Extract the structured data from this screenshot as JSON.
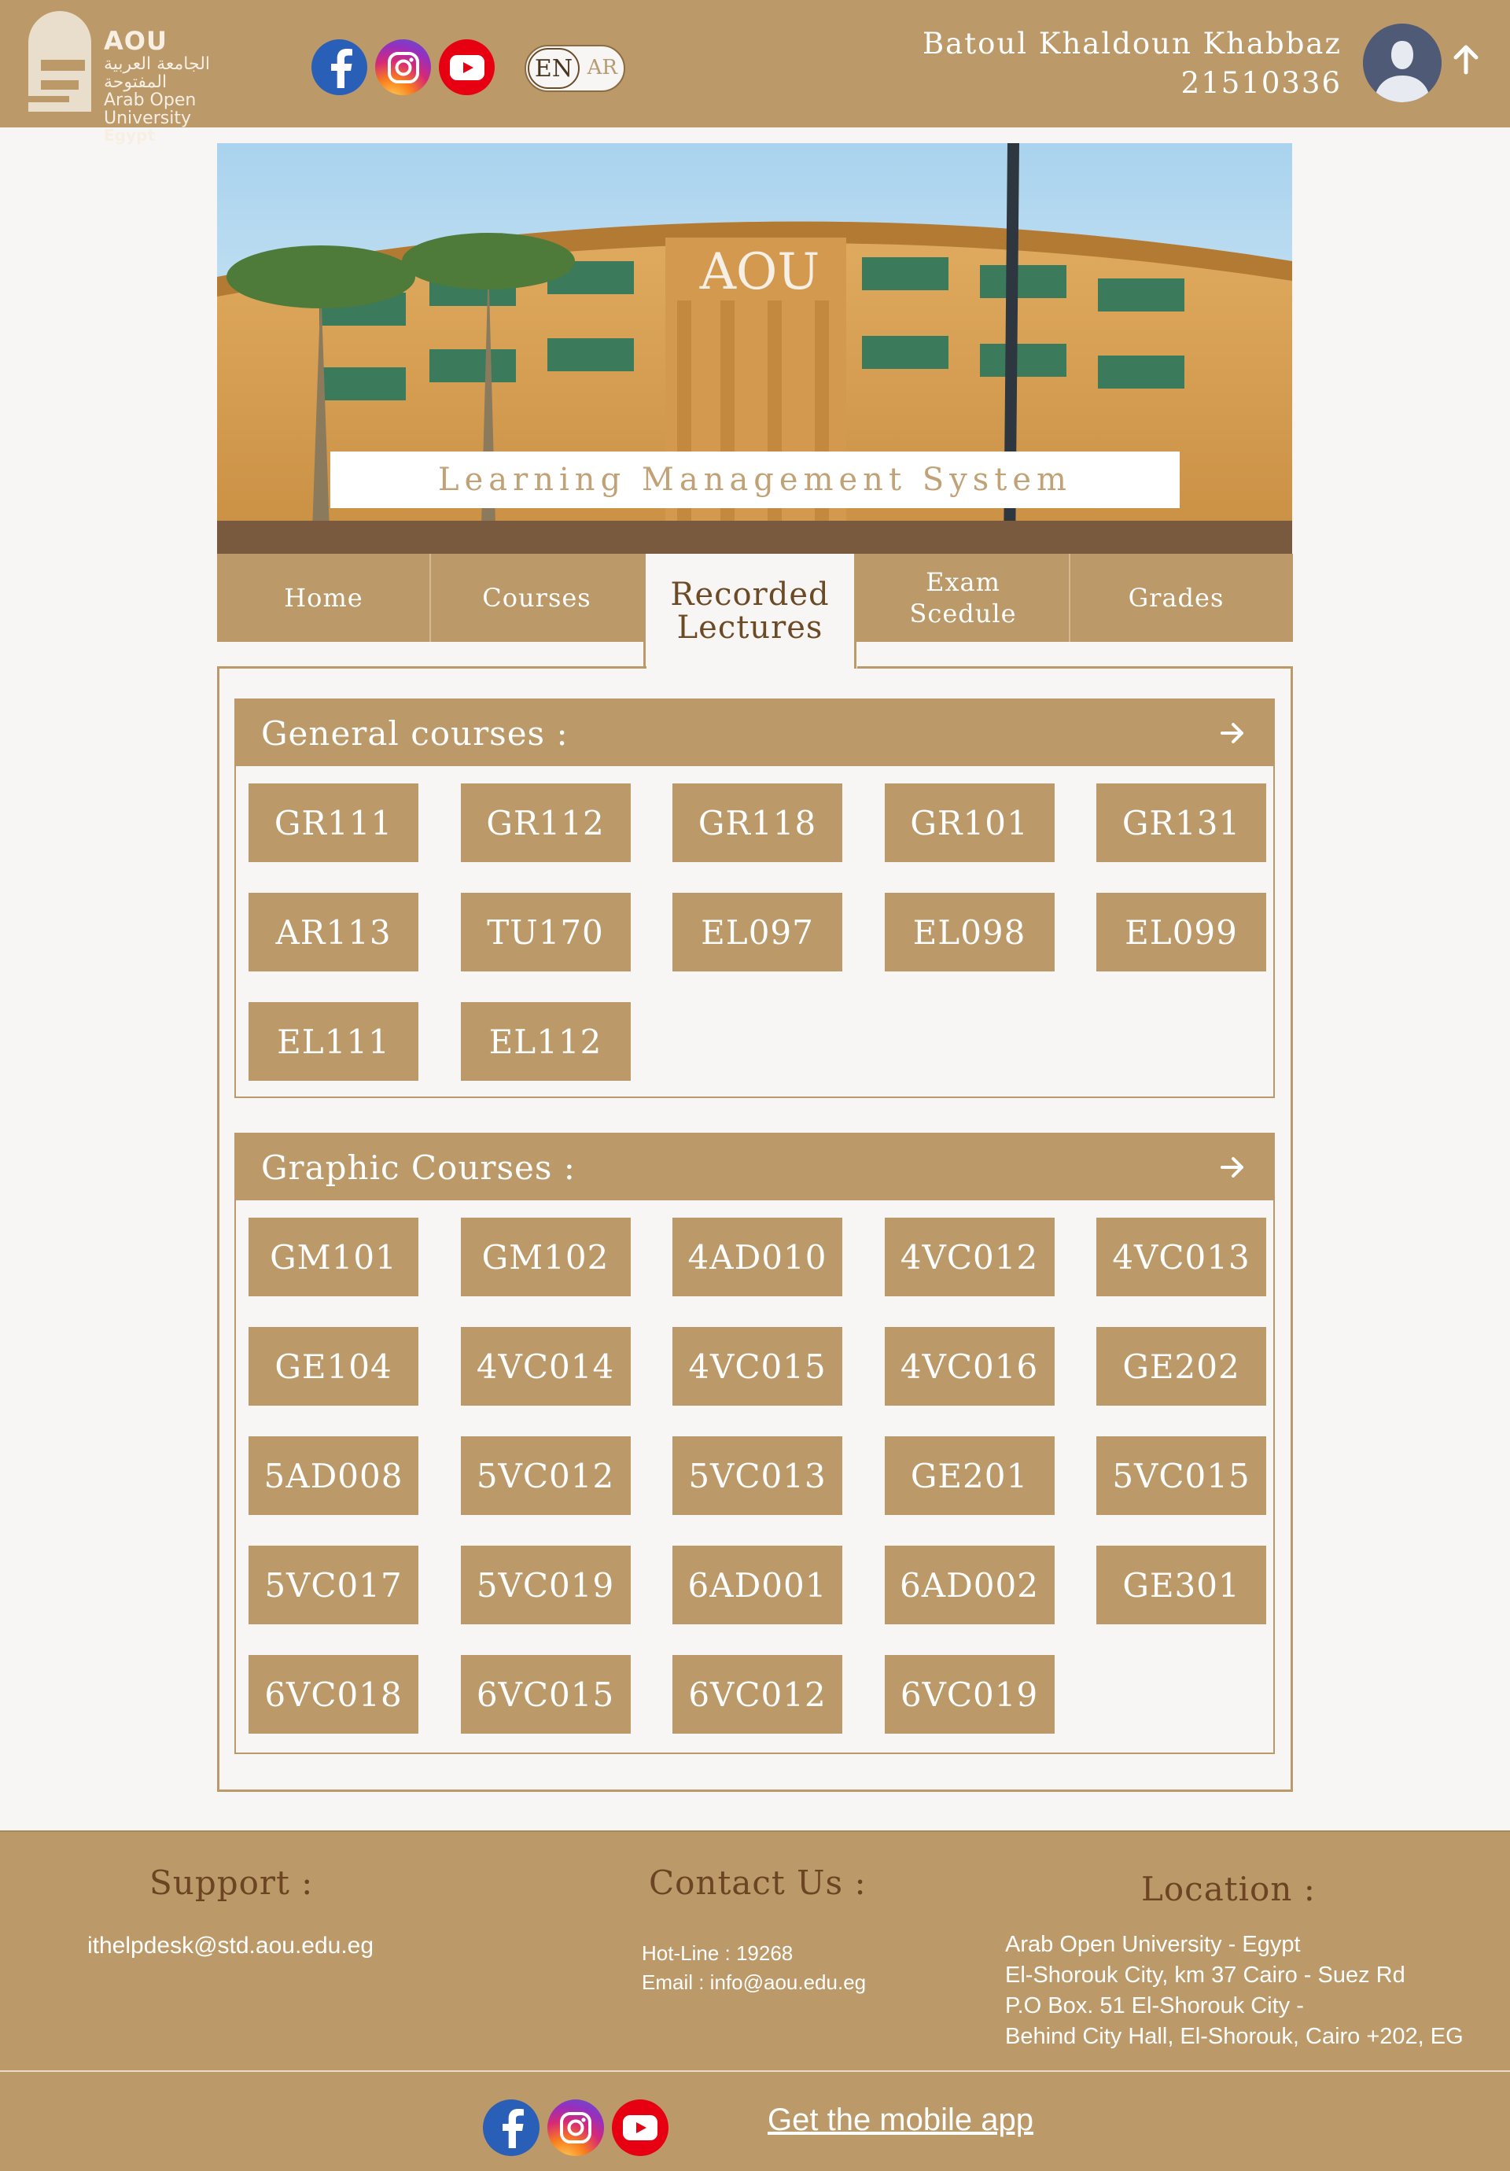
{
  "header": {
    "logo": {
      "abbr": "AOU",
      "arabic_name": "الجامعة العربية المفتوحة",
      "english_name": "Arab Open University",
      "country": "Egypt"
    },
    "language": {
      "active": "EN",
      "inactive": "AR"
    },
    "user": {
      "name": "Batoul Khaldoun Khabbaz",
      "id": "21510336"
    }
  },
  "banner": {
    "label": "Learning Management System",
    "building_sign": "AOU"
  },
  "nav": {
    "items": [
      {
        "label": "Home"
      },
      {
        "label": "Courses"
      },
      {
        "label": "Recorded\nLectures"
      },
      {
        "label": "Exam\nScedule"
      },
      {
        "label": "Grades"
      }
    ],
    "active_index": 2
  },
  "sections": {
    "general": {
      "title": "General courses :",
      "courses": [
        "GR111",
        "GR112",
        "GR118",
        "GR101",
        "GR131",
        "AR113",
        "TU170",
        "EL097",
        "EL098",
        "EL099",
        "EL111",
        "EL112"
      ]
    },
    "graphic": {
      "title": "Graphic Courses :",
      "courses": [
        "GM101",
        "GM102",
        "4AD010",
        "4VC012",
        "4VC013",
        "GE104",
        "4VC014",
        "4VC015",
        "4VC016",
        "GE202",
        "5AD008",
        "5VC012",
        "5VC013",
        "GE201",
        "5VC015",
        "5VC017",
        "5VC019",
        "6AD001",
        "6AD002",
        "GE301",
        "6VC018",
        "6VC015",
        "6VC012",
        "6VC019"
      ]
    }
  },
  "footer": {
    "support": {
      "heading": "Support :",
      "email": "ithelpdesk@std.aou.edu.eg"
    },
    "contact": {
      "heading": "Contact Us :",
      "hotline": "Hot-Line : 19268",
      "email": "Email : info@aou.edu.eg"
    },
    "location": {
      "heading": "Location :",
      "lines": [
        "Arab Open University - Egypt",
        "El-Shorouk City, km 37 Cairo - Suez Rd",
        "P.O Box. 51 El-Shorouk City -",
        "Behind City Hall, El-Shorouk, Cairo +202, EG"
      ]
    },
    "mobile_app": "Get the mobile app"
  },
  "icons": {
    "social": [
      "facebook-icon",
      "instagram-icon",
      "youtube-icon"
    ],
    "avatar": "user-avatar-icon",
    "scroll_top": "arrow-up-icon",
    "section_arrow": "arrow-right-icon"
  },
  "colors": {
    "brand": "#bb9968",
    "background": "#f8f6f4",
    "heading_dark": "#6c4423",
    "facebook": "#2a5fb8",
    "youtube": "#e60012"
  }
}
